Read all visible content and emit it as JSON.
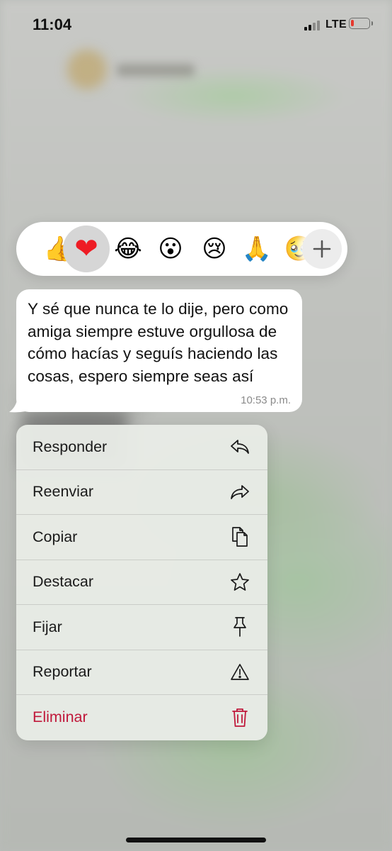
{
  "status_bar": {
    "time": "11:04",
    "network": "LTE",
    "signal_bars_active": 2,
    "signal_bars_total": 4,
    "battery_level_percent": 8,
    "battery_color": "#e63a2e"
  },
  "reactions": {
    "items": [
      {
        "name": "thumbs-up",
        "glyph": "👍"
      },
      {
        "name": "red-heart",
        "glyph": "❤",
        "selected": true
      },
      {
        "name": "tears-of-joy",
        "glyph": "😂"
      },
      {
        "name": "surprised",
        "glyph": "😮"
      },
      {
        "name": "crying",
        "glyph": "😢"
      },
      {
        "name": "praying-hands",
        "glyph": "🙏"
      },
      {
        "name": "pleading",
        "glyph": "🥹"
      }
    ],
    "add_icon": "plus-icon"
  },
  "message": {
    "text": "Y sé que nunca te lo dije, pero como amiga siempre estuve orgullosa de cómo hacías y seguís haciendo las cosas, espero siempre seas así",
    "time": "10:53 p.m."
  },
  "menu": {
    "items": [
      {
        "label": "Responder",
        "icon": "reply-icon"
      },
      {
        "label": "Reenviar",
        "icon": "forward-icon"
      },
      {
        "label": "Copiar",
        "icon": "copy-icon"
      },
      {
        "label": "Destacar",
        "icon": "star-icon"
      },
      {
        "label": "Fijar",
        "icon": "pin-icon"
      },
      {
        "label": "Reportar",
        "icon": "warning-icon"
      },
      {
        "label": "Eliminar",
        "icon": "trash-icon",
        "destructive": true
      }
    ],
    "destructive_color": "#c0183a"
  }
}
